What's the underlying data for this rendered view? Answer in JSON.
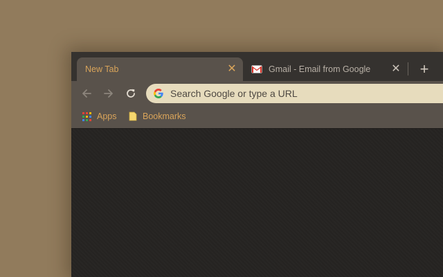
{
  "tabs": [
    {
      "title": "New Tab",
      "active": true
    },
    {
      "title": "Gmail - Email from Google",
      "active": false,
      "icon": "gmail-icon"
    }
  ],
  "toolbar": {
    "back_icon": "arrow-left-icon",
    "forward_icon": "arrow-right-icon",
    "reload_icon": "reload-icon"
  },
  "omnibox": {
    "placeholder": "Search Google or type a URL",
    "value": "",
    "icon": "google-g-icon"
  },
  "bookmarks": [
    {
      "label": "Apps",
      "icon": "apps-grid-icon"
    },
    {
      "label": "Bookmarks",
      "icon": "folder-icon"
    }
  ],
  "colors": {
    "desktop": "#917b5c",
    "tabstrip": "#35322f",
    "active_tab": "#59524b",
    "accent_text": "#d9a45a",
    "omnibox": "#e7dcbd",
    "content": "#262422"
  }
}
